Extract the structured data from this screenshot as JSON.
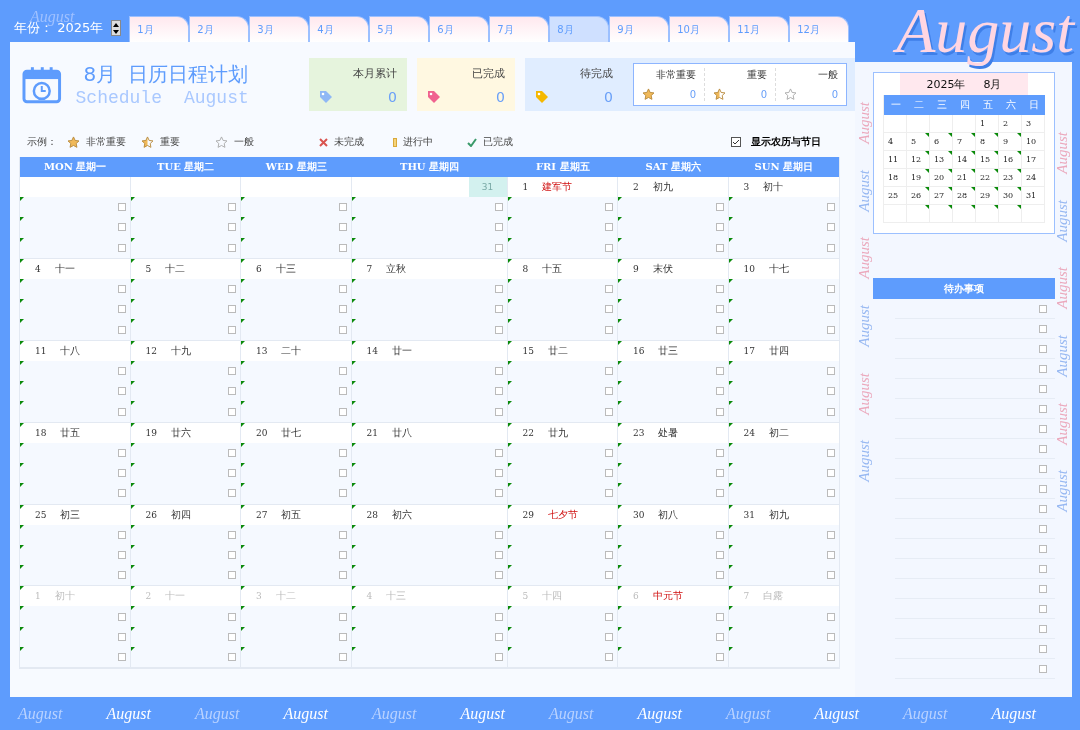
{
  "year_label": "年份：",
  "year": "2025年",
  "tabs": [
    {
      "label": "1月",
      "selected": false
    },
    {
      "label": "2月",
      "selected": false
    },
    {
      "label": "3月",
      "selected": false
    },
    {
      "label": "4月",
      "selected": false
    },
    {
      "label": "5月",
      "selected": false
    },
    {
      "label": "6月",
      "selected": false
    },
    {
      "label": "7月",
      "selected": false
    },
    {
      "label": "8月",
      "selected": true
    },
    {
      "label": "9月",
      "selected": false
    },
    {
      "label": "10月",
      "selected": false
    },
    {
      "label": "11月",
      "selected": false
    },
    {
      "label": "12月",
      "selected": false
    }
  ],
  "banner": "August",
  "header": {
    "month": "8月",
    "title": "日历日程计划",
    "subtitle": [
      "Schedule",
      "August"
    ]
  },
  "stats": [
    {
      "kind": "total",
      "label": "本月累计",
      "value": "0",
      "color": "#8fb8f5"
    },
    {
      "kind": "done",
      "label": "已完成",
      "value": "0",
      "color": "#f0628f"
    },
    {
      "kind": "pending",
      "label": "待完成",
      "value": "0",
      "color": "#f5b800"
    }
  ],
  "importance": [
    {
      "kind": "full",
      "label": "非常重要",
      "value": "0"
    },
    {
      "kind": "half",
      "label": "重要",
      "value": "0"
    },
    {
      "kind": "empty",
      "label": "一般",
      "value": "0"
    }
  ],
  "legend": {
    "label": "示例：",
    "items": [
      {
        "kind": "star_full",
        "label": "非常重要"
      },
      {
        "kind": "star_half",
        "label": "重要"
      },
      {
        "kind": "star_empty",
        "label": "一般"
      },
      {
        "kind": "cross",
        "label": "未完成"
      },
      {
        "kind": "progress",
        "label": "进行中"
      },
      {
        "kind": "check",
        "label": "已完成"
      }
    ]
  },
  "show_lunar": {
    "label": "显示农历与节日",
    "checked": true
  },
  "weekdays": [
    "MON 星期一",
    "TUE 星期二",
    "WED 星期三",
    "THU 星期四",
    "FRI 星期五",
    "SAT 星期六",
    "SUN 星期日"
  ],
  "weeks": [
    [
      {
        "kind": "empty",
        "tasks": [
          {
            "checked": false
          },
          {
            "checked": false
          },
          {
            "checked": false
          }
        ]
      },
      {
        "kind": "empty",
        "tasks": [
          {
            "checked": false
          },
          {
            "checked": false
          },
          {
            "checked": false
          }
        ]
      },
      {
        "kind": "empty",
        "tasks": [
          {
            "checked": false
          },
          {
            "checked": false
          },
          {
            "checked": false
          }
        ]
      },
      {
        "kind": "marker",
        "day": "31",
        "tasks": [
          {
            "checked": false
          },
          {
            "checked": false
          },
          {
            "checked": false
          }
        ]
      },
      {
        "kind": "day",
        "day": "1",
        "lunar": "建军节",
        "holiday": true,
        "tasks": [
          {
            "checked": false
          },
          {
            "checked": false
          },
          {
            "checked": false
          }
        ]
      },
      {
        "kind": "day",
        "day": "2",
        "lunar": "初九",
        "holiday": false,
        "tasks": [
          {
            "checked": false
          },
          {
            "checked": false
          },
          {
            "checked": false
          }
        ]
      },
      {
        "kind": "day",
        "day": "3",
        "lunar": "初十",
        "holiday": false,
        "tasks": [
          {
            "checked": false
          },
          {
            "checked": false
          },
          {
            "checked": false
          }
        ]
      }
    ],
    [
      {
        "kind": "day",
        "day": "4",
        "lunar": "十一",
        "holiday": false,
        "tasks": [
          {
            "checked": false
          },
          {
            "checked": false
          },
          {
            "checked": false
          }
        ]
      },
      {
        "kind": "day",
        "day": "5",
        "lunar": "十二",
        "holiday": false,
        "tasks": [
          {
            "checked": false
          },
          {
            "checked": false
          },
          {
            "checked": false
          }
        ]
      },
      {
        "kind": "day",
        "day": "6",
        "lunar": "十三",
        "holiday": false,
        "tasks": [
          {
            "checked": false
          },
          {
            "checked": false
          },
          {
            "checked": false
          }
        ]
      },
      {
        "kind": "day",
        "day": "7",
        "lunar": "立秋",
        "holiday": false,
        "tasks": [
          {
            "checked": false
          },
          {
            "checked": false
          },
          {
            "checked": false
          }
        ]
      },
      {
        "kind": "day",
        "day": "8",
        "lunar": "十五",
        "holiday": false,
        "tasks": [
          {
            "checked": false
          },
          {
            "checked": false
          },
          {
            "checked": false
          }
        ]
      },
      {
        "kind": "day",
        "day": "9",
        "lunar": "末伏",
        "holiday": false,
        "tasks": [
          {
            "checked": false
          },
          {
            "checked": false
          },
          {
            "checked": false
          }
        ]
      },
      {
        "kind": "day",
        "day": "10",
        "lunar": "十七",
        "holiday": false,
        "tasks": [
          {
            "checked": false
          },
          {
            "checked": false
          },
          {
            "checked": false
          }
        ]
      }
    ],
    [
      {
        "kind": "day",
        "day": "11",
        "lunar": "十八",
        "holiday": false,
        "tasks": [
          {
            "checked": false
          },
          {
            "checked": false
          },
          {
            "checked": false
          }
        ]
      },
      {
        "kind": "day",
        "day": "12",
        "lunar": "十九",
        "holiday": false,
        "tasks": [
          {
            "checked": false
          },
          {
            "checked": false
          },
          {
            "checked": false
          }
        ]
      },
      {
        "kind": "day",
        "day": "13",
        "lunar": "二十",
        "holiday": false,
        "tasks": [
          {
            "checked": false
          },
          {
            "checked": false
          },
          {
            "checked": false
          }
        ]
      },
      {
        "kind": "day",
        "day": "14",
        "lunar": "廿一",
        "holiday": false,
        "tasks": [
          {
            "checked": false
          },
          {
            "checked": false
          },
          {
            "checked": false
          }
        ]
      },
      {
        "kind": "day",
        "day": "15",
        "lunar": "廿二",
        "holiday": false,
        "tasks": [
          {
            "checked": false
          },
          {
            "checked": false
          },
          {
            "checked": false
          }
        ]
      },
      {
        "kind": "day",
        "day": "16",
        "lunar": "廿三",
        "holiday": false,
        "tasks": [
          {
            "checked": false
          },
          {
            "checked": false
          },
          {
            "checked": false
          }
        ]
      },
      {
        "kind": "day",
        "day": "17",
        "lunar": "廿四",
        "holiday": false,
        "tasks": [
          {
            "checked": false
          },
          {
            "checked": false
          },
          {
            "checked": false
          }
        ]
      }
    ],
    [
      {
        "kind": "day",
        "day": "18",
        "lunar": "廿五",
        "holiday": false,
        "tasks": [
          {
            "checked": false
          },
          {
            "checked": false
          },
          {
            "checked": false
          }
        ]
      },
      {
        "kind": "day",
        "day": "19",
        "lunar": "廿六",
        "holiday": false,
        "tasks": [
          {
            "checked": false
          },
          {
            "checked": false
          },
          {
            "checked": false
          }
        ]
      },
      {
        "kind": "day",
        "day": "20",
        "lunar": "廿七",
        "holiday": false,
        "tasks": [
          {
            "checked": false
          },
          {
            "checked": false
          },
          {
            "checked": false
          }
        ]
      },
      {
        "kind": "day",
        "day": "21",
        "lunar": "廿八",
        "holiday": false,
        "tasks": [
          {
            "checked": false
          },
          {
            "checked": false
          },
          {
            "checked": false
          }
        ]
      },
      {
        "kind": "day",
        "day": "22",
        "lunar": "廿九",
        "holiday": false,
        "tasks": [
          {
            "checked": false
          },
          {
            "checked": false
          },
          {
            "checked": false
          }
        ]
      },
      {
        "kind": "day",
        "day": "23",
        "lunar": "处暑",
        "holiday": false,
        "tasks": [
          {
            "checked": false
          },
          {
            "checked": false
          },
          {
            "checked": false
          }
        ]
      },
      {
        "kind": "day",
        "day": "24",
        "lunar": "初二",
        "holiday": false,
        "tasks": [
          {
            "checked": false
          },
          {
            "checked": false
          },
          {
            "checked": false
          }
        ]
      }
    ],
    [
      {
        "kind": "day",
        "day": "25",
        "lunar": "初三",
        "holiday": false,
        "tasks": [
          {
            "checked": false
          },
          {
            "checked": false
          },
          {
            "checked": false
          }
        ]
      },
      {
        "kind": "day",
        "day": "26",
        "lunar": "初四",
        "holiday": false,
        "tasks": [
          {
            "checked": false
          },
          {
            "checked": false
          },
          {
            "checked": false
          }
        ]
      },
      {
        "kind": "day",
        "day": "27",
        "lunar": "初五",
        "holiday": false,
        "tasks": [
          {
            "checked": false
          },
          {
            "checked": false
          },
          {
            "checked": false
          }
        ]
      },
      {
        "kind": "day",
        "day": "28",
        "lunar": "初六",
        "holiday": false,
        "tasks": [
          {
            "checked": false
          },
          {
            "checked": false
          },
          {
            "checked": false
          }
        ]
      },
      {
        "kind": "day",
        "day": "29",
        "lunar": "七夕节",
        "holiday": true,
        "tasks": [
          {
            "checked": false
          },
          {
            "checked": false
          },
          {
            "checked": false
          }
        ]
      },
      {
        "kind": "day",
        "day": "30",
        "lunar": "初八",
        "holiday": false,
        "tasks": [
          {
            "checked": false
          },
          {
            "checked": false
          },
          {
            "checked": false
          }
        ]
      },
      {
        "kind": "day",
        "day": "31",
        "lunar": "初九",
        "holiday": false,
        "tasks": [
          {
            "checked": false
          },
          {
            "checked": false
          },
          {
            "checked": false
          }
        ]
      }
    ],
    [
      {
        "kind": "next",
        "day": "1",
        "lunar": "初十",
        "holiday": false,
        "tasks": [
          {
            "checked": false
          },
          {
            "checked": false
          },
          {
            "checked": false
          }
        ]
      },
      {
        "kind": "next",
        "day": "2",
        "lunar": "十一",
        "holiday": false,
        "tasks": [
          {
            "checked": false
          },
          {
            "checked": false
          },
          {
            "checked": false
          }
        ]
      },
      {
        "kind": "next",
        "day": "3",
        "lunar": "十二",
        "holiday": false,
        "tasks": [
          {
            "checked": false
          },
          {
            "checked": false
          },
          {
            "checked": false
          }
        ]
      },
      {
        "kind": "next",
        "day": "4",
        "lunar": "十三",
        "holiday": false,
        "tasks": [
          {
            "checked": false
          },
          {
            "checked": false
          },
          {
            "checked": false
          }
        ]
      },
      {
        "kind": "next",
        "day": "5",
        "lunar": "十四",
        "holiday": false,
        "tasks": [
          {
            "checked": false
          },
          {
            "checked": false
          },
          {
            "checked": false
          }
        ]
      },
      {
        "kind": "next",
        "day": "6",
        "lunar": "中元节",
        "holiday": true,
        "tasks": [
          {
            "checked": false
          },
          {
            "checked": false
          },
          {
            "checked": false
          }
        ]
      },
      {
        "kind": "next",
        "day": "7",
        "lunar": "白露",
        "holiday": false,
        "tasks": [
          {
            "checked": false
          },
          {
            "checked": false
          },
          {
            "checked": false
          }
        ]
      }
    ]
  ],
  "mini_calendar": {
    "year": "2025年",
    "month": "8月",
    "weekdays": [
      "一",
      "二",
      "三",
      "四",
      "五",
      "六",
      "日"
    ],
    "weeks": [
      [
        {
          "note": false
        },
        {
          "note": false
        },
        {
          "note": false
        },
        {
          "note": false
        },
        {
          "day": "1",
          "note": false
        },
        {
          "day": "2",
          "note": false
        },
        {
          "day": "3",
          "note": false
        }
      ],
      [
        {
          "day": "4",
          "note": false
        },
        {
          "day": "5",
          "note": true
        },
        {
          "day": "6",
          "note": true
        },
        {
          "day": "7",
          "note": true
        },
        {
          "day": "8",
          "note": true
        },
        {
          "day": "9",
          "note": true
        },
        {
          "day": "10",
          "note": false
        }
      ],
      [
        {
          "day": "11",
          "note": false
        },
        {
          "day": "12",
          "note": true
        },
        {
          "day": "13",
          "note": true
        },
        {
          "day": "14",
          "note": true
        },
        {
          "day": "15",
          "note": true
        },
        {
          "day": "16",
          "note": true
        },
        {
          "day": "17",
          "note": false
        }
      ],
      [
        {
          "day": "18",
          "note": false
        },
        {
          "day": "19",
          "note": true
        },
        {
          "day": "20",
          "note": true
        },
        {
          "day": "21",
          "note": true
        },
        {
          "day": "22",
          "note": true
        },
        {
          "day": "23",
          "note": true
        },
        {
          "day": "24",
          "note": false
        }
      ],
      [
        {
          "day": "25",
          "note": false
        },
        {
          "day": "26",
          "note": true
        },
        {
          "day": "27",
          "note": true
        },
        {
          "day": "28",
          "note": true
        },
        {
          "day": "29",
          "note": true
        },
        {
          "day": "30",
          "note": true
        },
        {
          "day": "31",
          "note": false
        }
      ],
      [
        {
          "note": false
        },
        {
          "note": true
        },
        {
          "note": true
        },
        {
          "note": true
        },
        {
          "note": true
        },
        {
          "note": true
        },
        {
          "note": false
        }
      ]
    ]
  },
  "todo": {
    "title": "待办事项",
    "items": [
      {
        "checked": false
      },
      {
        "checked": false
      },
      {
        "checked": false
      },
      {
        "checked": false
      },
      {
        "checked": false
      },
      {
        "checked": false
      },
      {
        "checked": false
      },
      {
        "checked": false
      },
      {
        "checked": false
      },
      {
        "checked": false
      },
      {
        "checked": false
      },
      {
        "checked": false
      },
      {
        "checked": false
      },
      {
        "checked": false
      },
      {
        "checked": false
      },
      {
        "checked": false
      },
      {
        "checked": false
      },
      {
        "checked": false
      },
      {
        "checked": false
      }
    ]
  },
  "decor_top": "August",
  "decor_side_left": [
    "August",
    "August",
    "August",
    "August",
    "August",
    "August"
  ],
  "decor_side_right": [
    "August",
    "August",
    "August",
    "August",
    "August",
    "August"
  ],
  "decor_bottom": [
    "August",
    "August",
    "August",
    "August",
    "August",
    "August",
    "August",
    "August",
    "August",
    "August",
    "August",
    "August"
  ]
}
